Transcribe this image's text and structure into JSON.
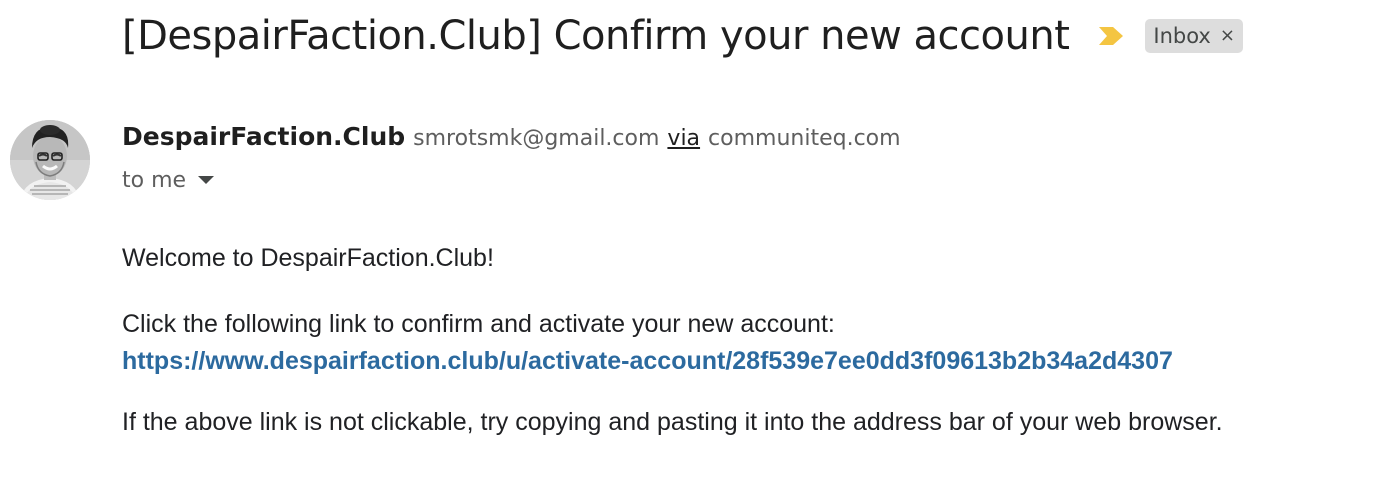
{
  "email": {
    "subject": "[DespairFaction.Club] Confirm your new account",
    "importance_icon": "importance-marker-icon",
    "label": {
      "text": "Inbox",
      "remove_symbol": "×"
    },
    "sender": {
      "name": "DespairFaction.Club",
      "email": "smrotsmk@gmail.com",
      "via_label": "via",
      "via_domain": "communiteq.com"
    },
    "recipient_text": "to me",
    "body": {
      "welcome": "Welcome to DespairFaction.Club!",
      "instruction": "Click the following link to confirm and activate your new account:",
      "link": "https://www.despairfaction.club/u/activate-account/28f539e7ee0dd3f09613b2b34a2d4307",
      "fallback": "If the above link is not clickable, try copying and pasting it into the address bar of your web browser."
    }
  },
  "colors": {
    "link": "#2c6a9f",
    "importance": "#f4c542",
    "chip_bg": "#dddddd"
  }
}
